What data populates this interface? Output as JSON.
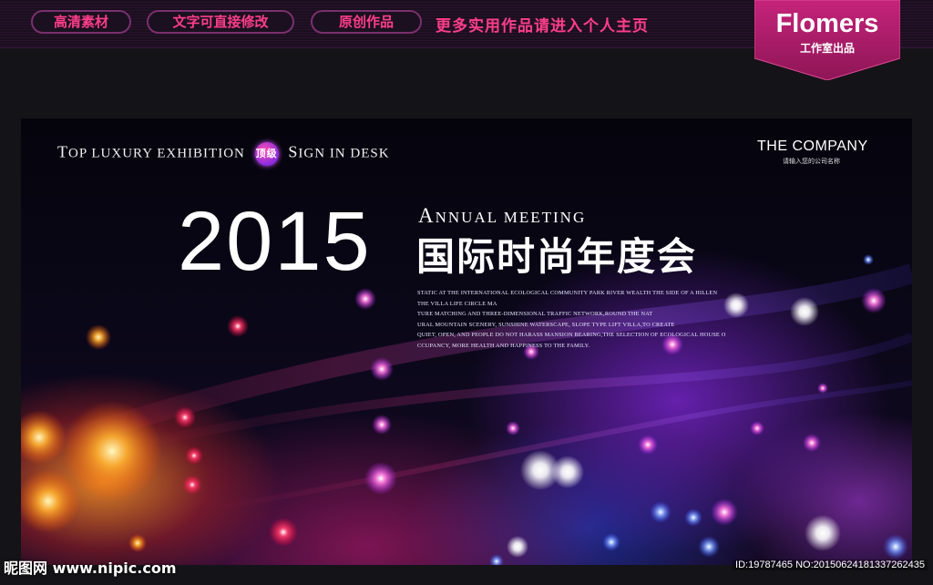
{
  "topbar": {
    "pills": [
      "高清素材",
      "文字可直接修改",
      "原创作品"
    ],
    "promo": "更多实用作品请进入个人主页",
    "badge": {
      "brand": "Flomers",
      "sub": "工作室出品"
    }
  },
  "banner": {
    "tagline": {
      "t1_cap": "T",
      "t1": "OP LUXURY EXHIBITION",
      "badge": "顶级",
      "t2_cap": "S",
      "t2": "IGN IN DESK"
    },
    "company": {
      "name": "THE COMPANY",
      "sub": "请输入您的公司名称"
    },
    "year": "2015",
    "annual": {
      "cap": "A",
      "rest": "NNUAL MEETING"
    },
    "headline": "国际时尚年度会",
    "body_lines": [
      "STATIC AT THE INTERNATIONAL ECOLOGICAL COMMUNITY PARK RIVER WEALTH THE SIDE OF A HILLEN",
      "THE VILLA LIFE CIRCLE MA",
      "TURE MATCHING AND THREE-DIMENSIONAL TRAFFIC NETWORK,ROUND THE NAT",
      "URAL MOUNTAIN SCENERY, SUNSHINE WATERSCAPE, SLOPE TYPE LIFT VILLA,TO CREATE",
      "QUIET, OPEN, AND PEOPLE DO NOT HARASS MANSION BEARING,THE SELECTION OF ECOLOGICAL HOUSE O",
      "CCUPANCY, MORE HEALTH AND HAPPINESS TO THE FAMILY."
    ]
  },
  "footer": {
    "watermark": "昵图网 www.nipic.com",
    "id_text": "ID:19787465 NO:20150624181337262435"
  },
  "colors": {
    "accent": "#ff3d8b",
    "badge": "#b0206a",
    "pill_border": "#7a2f6e"
  }
}
